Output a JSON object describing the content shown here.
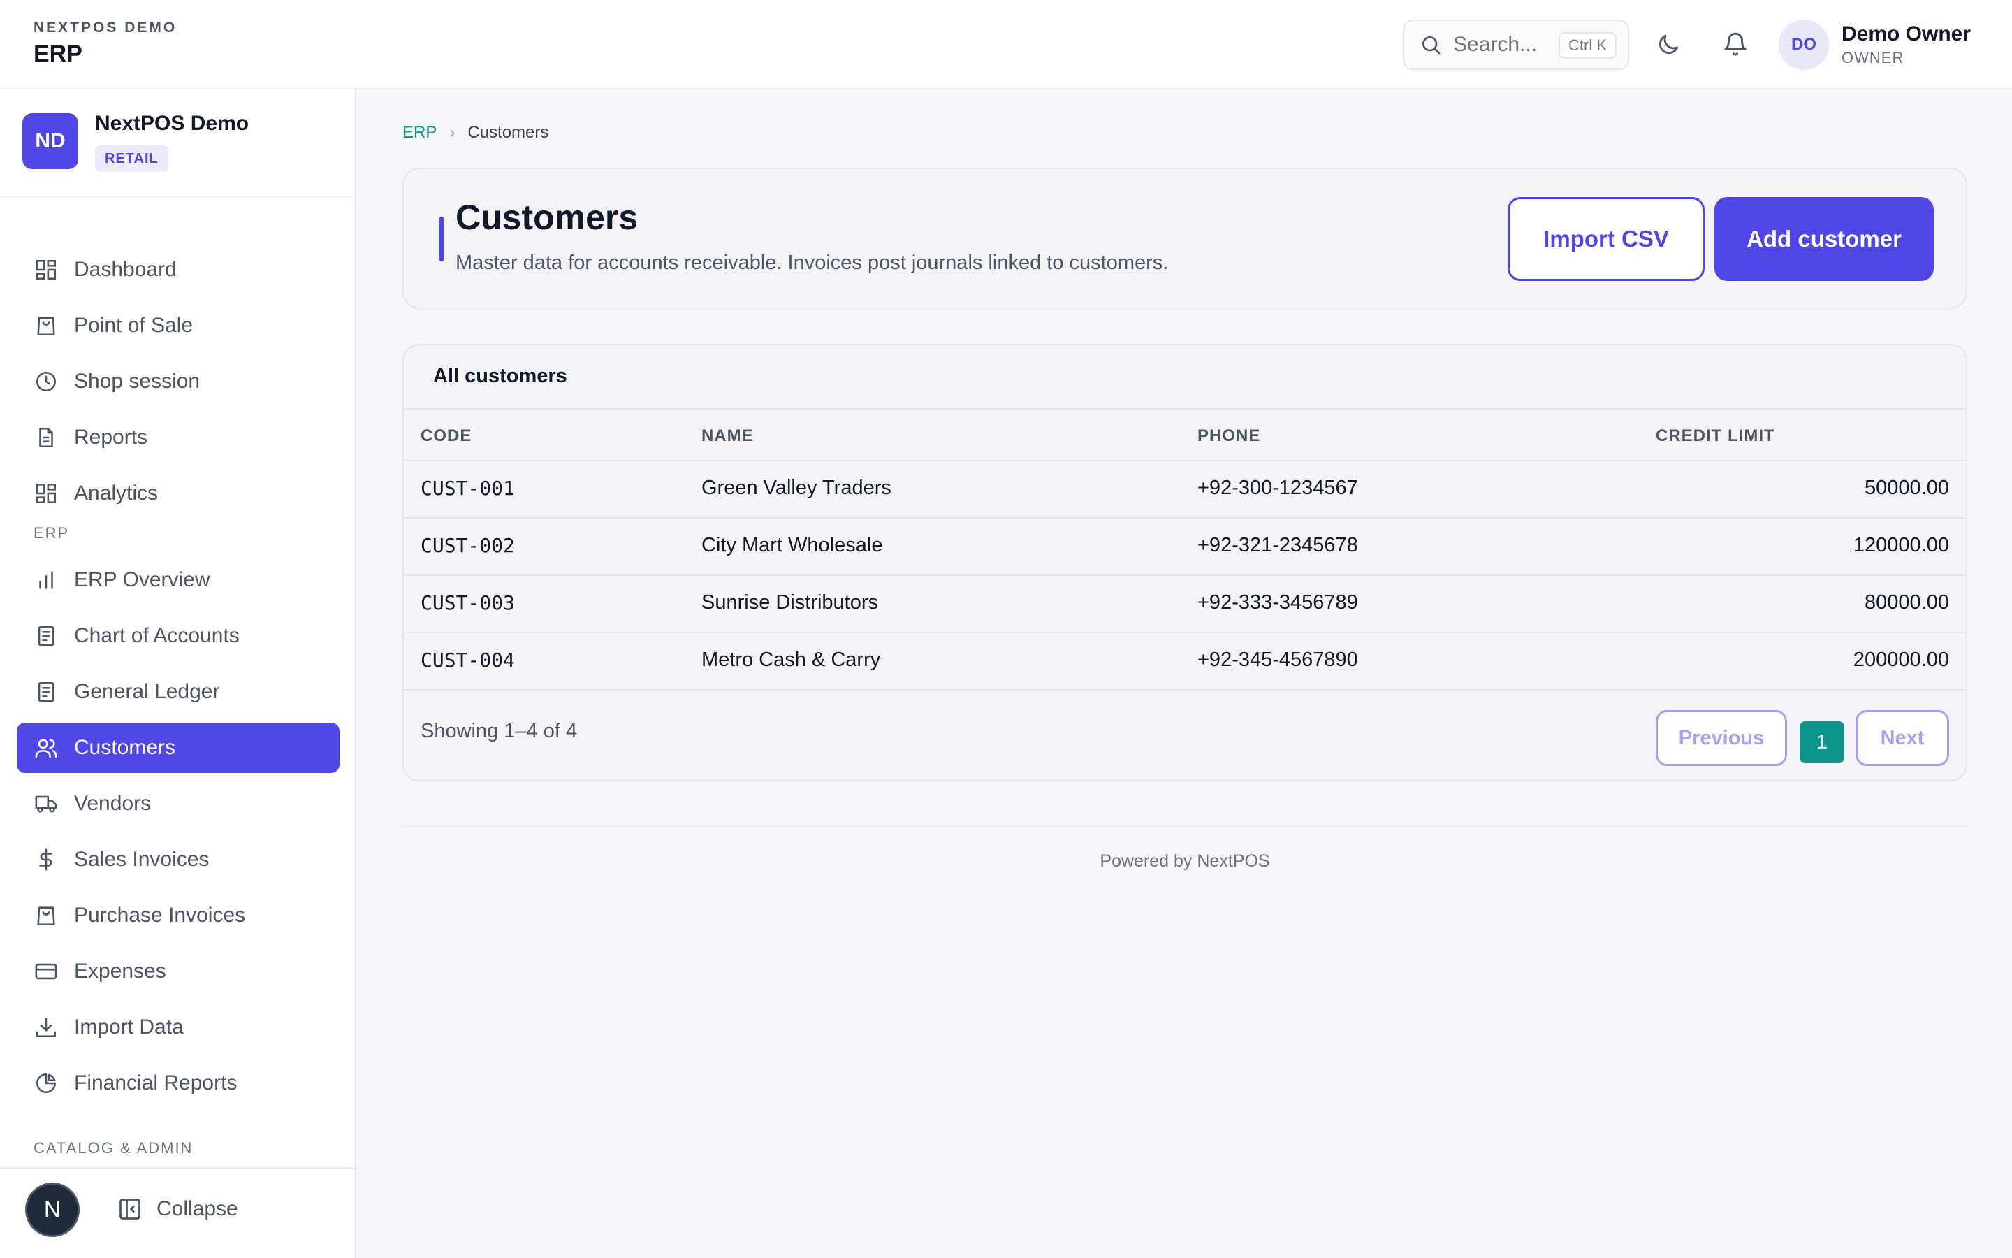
{
  "topbar": {
    "org": "NEXTPOS DEMO",
    "app": "ERP",
    "search_placeholder": "Search...",
    "search_shortcut": "Ctrl K",
    "user_initials": "DO",
    "user_name": "Demo Owner",
    "user_role": "OWNER",
    "icons": [
      "search-icon",
      "moon-icon",
      "bell-icon"
    ]
  },
  "sidebar": {
    "org_initials": "ND",
    "org_name": "NextPOS Demo",
    "org_badge": "RETAIL",
    "items": [
      {
        "label": "Dashboard",
        "icon": "grid-icon"
      },
      {
        "label": "Point of Sale",
        "icon": "bag-icon"
      },
      {
        "label": "Shop session",
        "icon": "clock-icon"
      },
      {
        "label": "Reports",
        "icon": "document-icon"
      },
      {
        "label": "Analytics",
        "icon": "grid-icon"
      }
    ],
    "section_erp": "ERP",
    "erp_items": [
      {
        "label": "ERP Overview",
        "icon": "bar-chart-icon"
      },
      {
        "label": "Chart of Accounts",
        "icon": "ledger-icon"
      },
      {
        "label": "General Ledger",
        "icon": "ledger-icon"
      },
      {
        "label": "Customers",
        "icon": "users-icon",
        "active": true
      },
      {
        "label": "Vendors",
        "icon": "truck-icon"
      },
      {
        "label": "Sales Invoices",
        "icon": "dollar-icon"
      },
      {
        "label": "Purchase Invoices",
        "icon": "bag-icon"
      },
      {
        "label": "Expenses",
        "icon": "card-icon"
      },
      {
        "label": "Import Data",
        "icon": "download-icon"
      },
      {
        "label": "Financial Reports",
        "icon": "pie-chart-icon"
      }
    ],
    "section_catalog": "CATALOG & ADMIN",
    "logo_letter": "N",
    "collapse_label": "Collapse"
  },
  "breadcrumb": {
    "root": "ERP",
    "current": "Customers"
  },
  "header": {
    "title": "Customers",
    "subtitle": "Master data for accounts receivable. Invoices post journals linked to customers.",
    "import_label": "Import CSV",
    "add_label": "Add customer"
  },
  "table": {
    "title": "All customers",
    "columns": [
      "CODE",
      "NAME",
      "PHONE",
      "CREDIT LIMIT"
    ],
    "rows": [
      {
        "code": "CUST-001",
        "name": "Green Valley Traders",
        "phone": "+92-300-1234567",
        "limit": "50000.00"
      },
      {
        "code": "CUST-002",
        "name": "City Mart Wholesale",
        "phone": "+92-321-2345678",
        "limit": "120000.00"
      },
      {
        "code": "CUST-003",
        "name": "Sunrise Distributors",
        "phone": "+92-333-3456789",
        "limit": "80000.00"
      },
      {
        "code": "CUST-004",
        "name": "Metro Cash & Carry",
        "phone": "+92-345-4567890",
        "limit": "200000.00"
      }
    ],
    "showing": "Showing 1–4 of 4",
    "prev_label": "Previous",
    "page": "1",
    "next_label": "Next"
  },
  "footer": {
    "powered": "Powered by NextPOS"
  },
  "colors": {
    "accent": "#4f46e5",
    "teal": "#0d9488"
  }
}
